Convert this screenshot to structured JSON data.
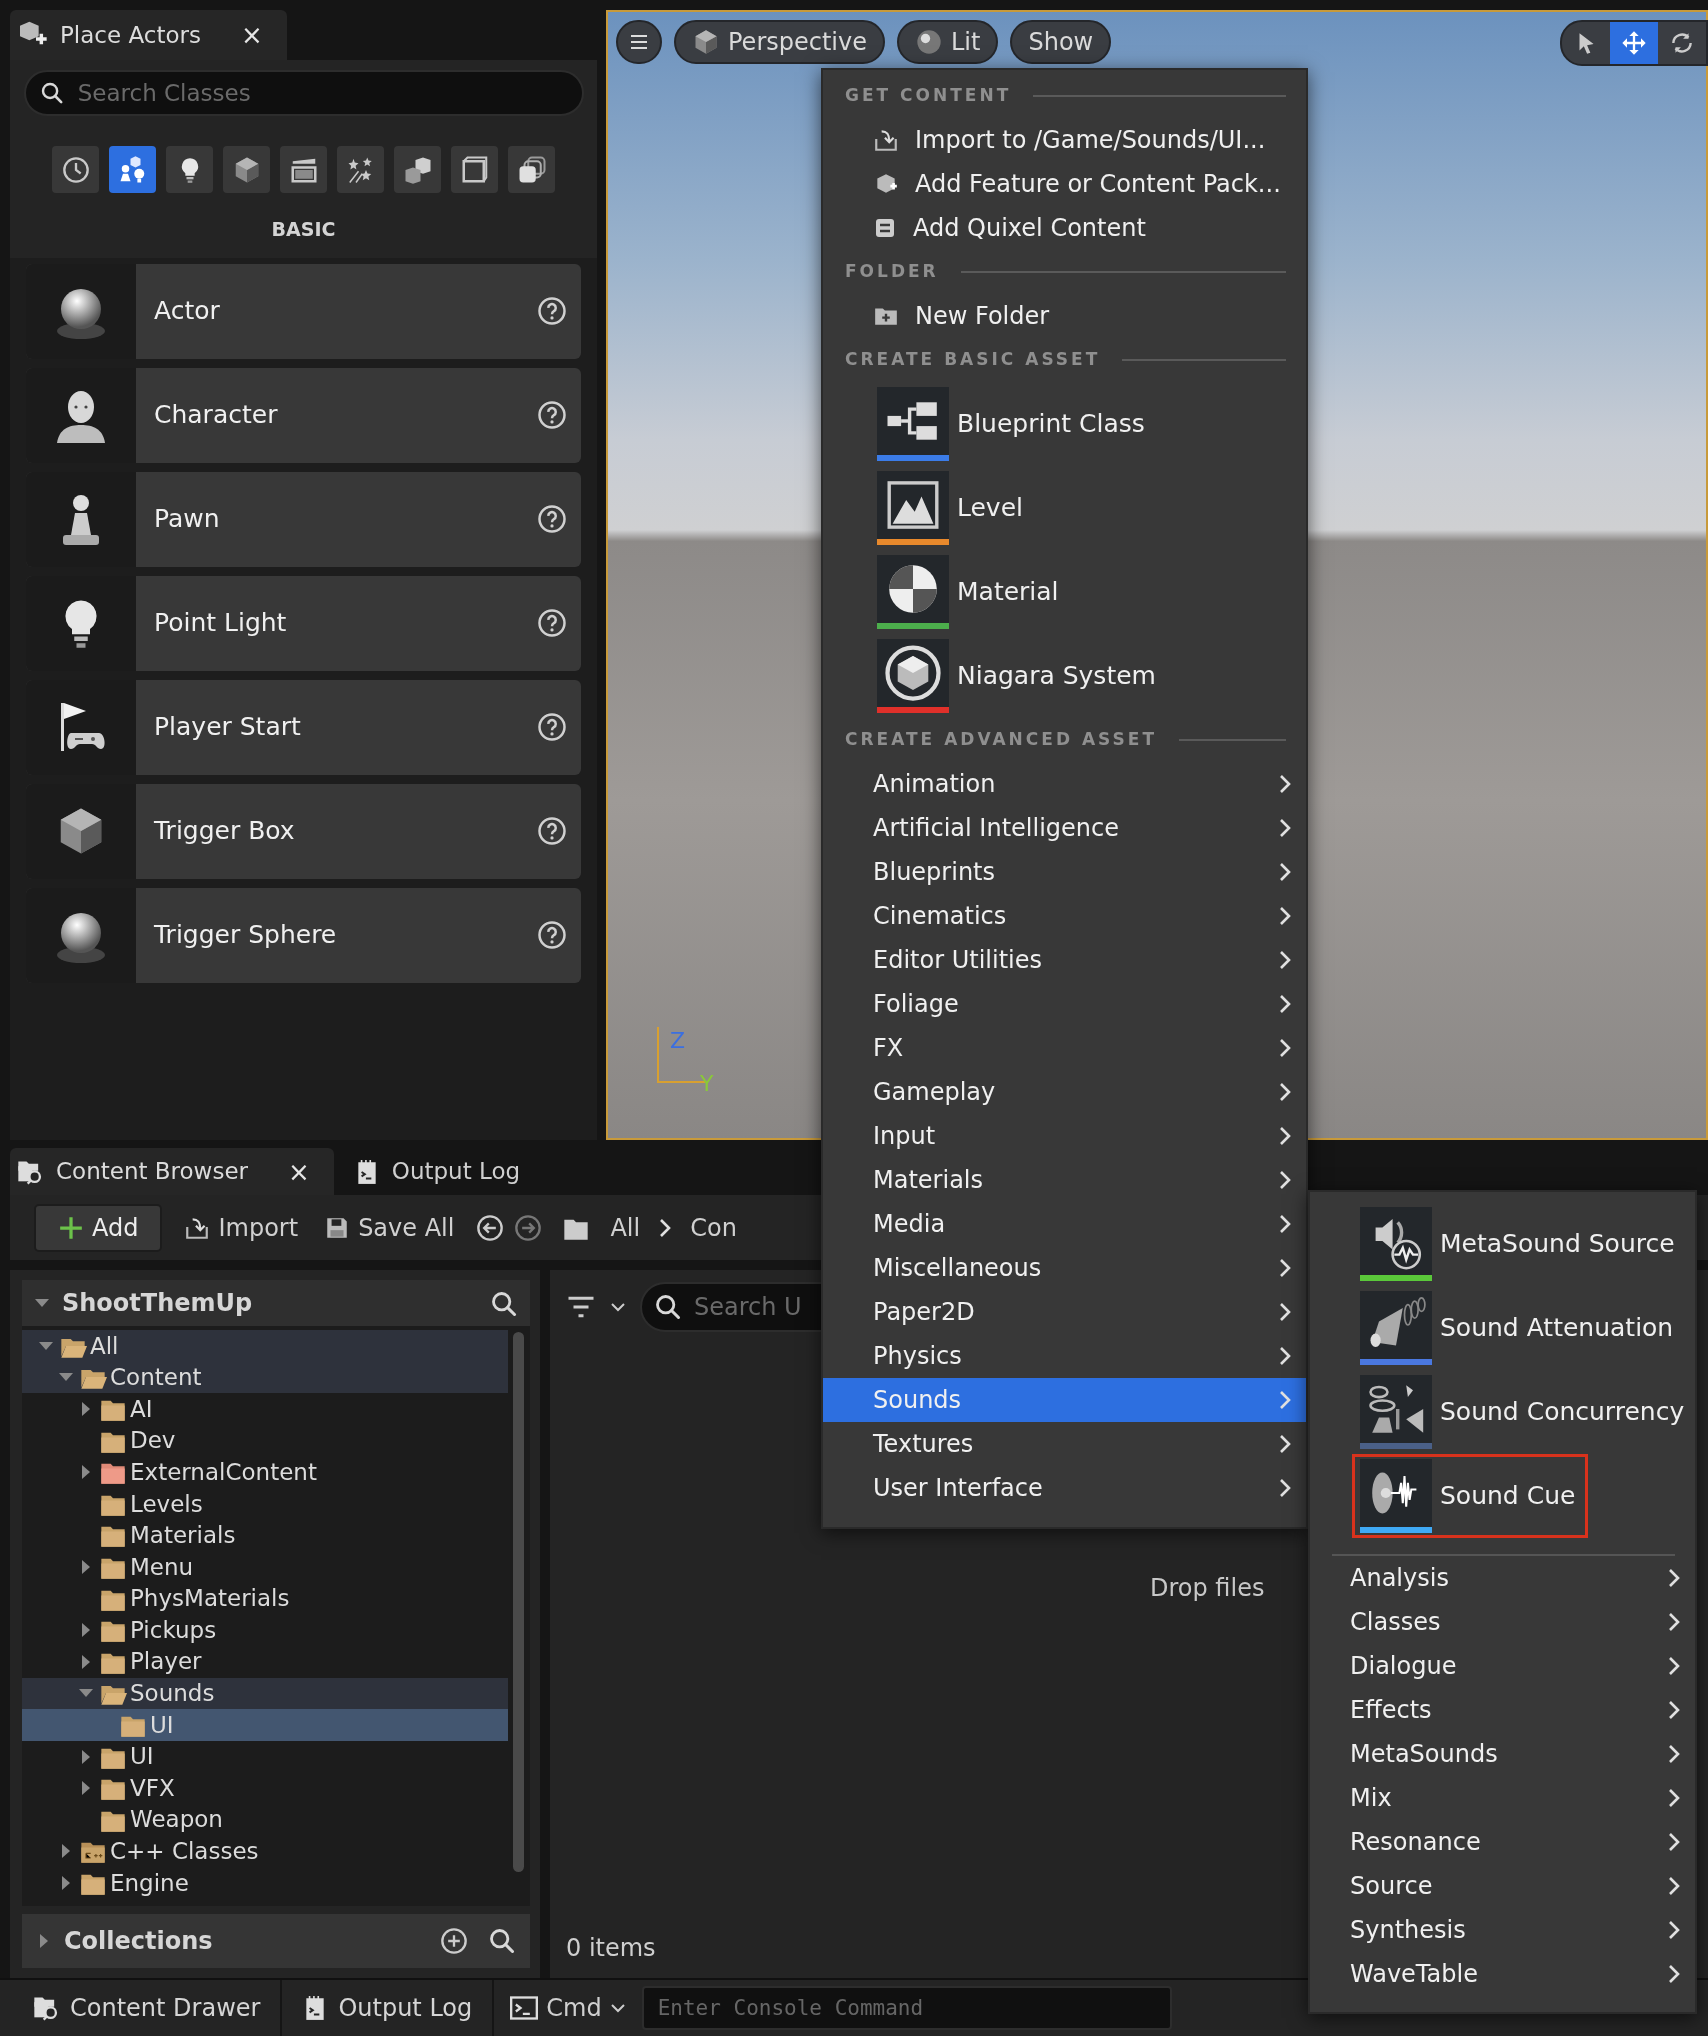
{
  "place_actors": {
    "tab": {
      "title": "Place Actors",
      "close": "×"
    },
    "search": {
      "placeholder": "Search Classes"
    },
    "categories": [
      {
        "kind": "clock",
        "selected": false
      },
      {
        "kind": "basic",
        "selected": true
      },
      {
        "kind": "bulb",
        "selected": false
      },
      {
        "kind": "cube",
        "selected": false
      },
      {
        "kind": "clapper",
        "selected": false
      },
      {
        "kind": "stars",
        "selected": false
      },
      {
        "kind": "blocks",
        "selected": false
      },
      {
        "kind": "volume",
        "selected": false
      },
      {
        "kind": "stack",
        "selected": false
      }
    ],
    "category_title": "BASIC",
    "actors": [
      {
        "name": "Actor",
        "kind": "sphere"
      },
      {
        "name": "Character",
        "kind": "person"
      },
      {
        "name": "Pawn",
        "kind": "pawn"
      },
      {
        "name": "Point Light",
        "kind": "bulb"
      },
      {
        "name": "Player Start",
        "kind": "flag"
      },
      {
        "name": "Trigger Box",
        "kind": "cube"
      },
      {
        "name": "Trigger Sphere",
        "kind": "sphere"
      }
    ]
  },
  "viewport": {
    "toolbar": [
      {
        "kind": "menu"
      },
      {
        "kind": "cube",
        "label": "Perspective"
      },
      {
        "kind": "lit",
        "label": "Lit"
      },
      {
        "kind": "plain",
        "label": "Show"
      }
    ],
    "transform_tools": [
      {
        "kind": "select",
        "selected": false
      },
      {
        "kind": "move",
        "selected": true
      },
      {
        "kind": "rotate",
        "selected": false
      }
    ],
    "axis_gizmo": {
      "z": "Z",
      "y": "Y"
    }
  },
  "content_browser": {
    "tabs": [
      {
        "label": "Content Browser",
        "kind": "drawer",
        "selected": true,
        "close": "×"
      },
      {
        "label": "Output Log",
        "kind": "log",
        "selected": false
      }
    ],
    "toolbar": {
      "add": "Add",
      "import": "Import",
      "save_all": "Save All",
      "breadcrumb": [
        "All",
        "Con"
      ]
    },
    "sources": {
      "title": "ShootThemUp",
      "tree": [
        {
          "label": "All",
          "kind": "folder",
          "expandable": true,
          "expanded": true,
          "selected": false,
          "children": [
            {
              "label": "Content",
              "kind": "folder",
              "expandable": true,
              "expanded": true,
              "selected": false,
              "children": [
                {
                  "label": "AI",
                  "kind": "folder",
                  "expandable": true,
                  "expanded": false,
                  "selected": false
                },
                {
                  "label": "Dev",
                  "kind": "folder",
                  "expandable": false,
                  "expanded": false,
                  "selected": false
                },
                {
                  "label": "ExternalContent",
                  "kind": "external",
                  "expandable": true,
                  "expanded": false,
                  "selected": false
                },
                {
                  "label": "Levels",
                  "kind": "folder",
                  "expandable": false,
                  "expanded": false,
                  "selected": false
                },
                {
                  "label": "Materials",
                  "kind": "folder",
                  "expandable": false,
                  "expanded": false,
                  "selected": false
                },
                {
                  "label": "Menu",
                  "kind": "folder",
                  "expandable": true,
                  "expanded": false,
                  "selected": false
                },
                {
                  "label": "PhysMaterials",
                  "kind": "folder",
                  "expandable": false,
                  "expanded": false,
                  "selected": false
                },
                {
                  "label": "Pickups",
                  "kind": "folder",
                  "expandable": true,
                  "expanded": false,
                  "selected": false
                },
                {
                  "label": "Player",
                  "kind": "folder",
                  "expandable": true,
                  "expanded": false,
                  "selected": false
                },
                {
                  "label": "Sounds",
                  "kind": "folder",
                  "expandable": true,
                  "expanded": true,
                  "selected": false,
                  "children": [
                    {
                      "label": "UI",
                      "kind": "folder",
                      "expandable": false,
                      "expanded": false,
                      "selected": true
                    }
                  ]
                },
                {
                  "label": "UI",
                  "kind": "folder",
                  "expandable": true,
                  "expanded": false,
                  "selected": false
                },
                {
                  "label": "VFX",
                  "kind": "folder",
                  "expandable": true,
                  "expanded": false,
                  "selected": false
                },
                {
                  "label": "Weapon",
                  "kind": "folder",
                  "expandable": false,
                  "expanded": false,
                  "selected": false
                }
              ]
            },
            {
              "label": "C++ Classes",
              "kind": "code",
              "expandable": true,
              "expanded": false,
              "selected": false
            },
            {
              "label": "Engine",
              "kind": "folder",
              "expandable": true,
              "expanded": false,
              "selected": false
            }
          ]
        }
      ],
      "collections": "Collections"
    },
    "assets": {
      "search": {
        "placeholder": "Search U"
      },
      "drop_hint": "Drop files",
      "count": "0 items"
    }
  },
  "status_bar": {
    "buttons": [
      {
        "label": "Content Drawer",
        "kind": "drawer"
      },
      {
        "label": "Output Log",
        "kind": "log"
      }
    ],
    "console": {
      "label": "Cmd",
      "placeholder": "Enter Console Command"
    }
  },
  "add_menu": {
    "sections": [
      {
        "title": "GET CONTENT",
        "kind": "small",
        "items": [
          {
            "label": "Import to /Game/Sounds/UI...",
            "kind": "import"
          },
          {
            "label": "Add Feature or Content Pack...",
            "kind": "pack"
          },
          {
            "label": "Add Quixel Content",
            "kind": "quixel"
          }
        ]
      },
      {
        "title": "FOLDER",
        "kind": "small",
        "items": [
          {
            "label": "New Folder",
            "kind": "newfolder"
          }
        ]
      },
      {
        "title": "CREATE BASIC ASSET",
        "kind": "large",
        "items": [
          {
            "label": "Blueprint Class",
            "kind": "blueprint",
            "color": "#3b7ce8"
          },
          {
            "label": "Level",
            "kind": "level",
            "color": "#e8892c"
          },
          {
            "label": "Material",
            "kind": "material",
            "color": "#4cae4c"
          },
          {
            "label": "Niagara System",
            "kind": "niagara",
            "color": "#e0302a"
          }
        ]
      },
      {
        "title": "CREATE ADVANCED ASSET",
        "kind": "submenu",
        "items": [
          {
            "label": "Animation",
            "selected": false
          },
          {
            "label": "Artificial Intelligence",
            "selected": false
          },
          {
            "label": "Blueprints",
            "selected": false
          },
          {
            "label": "Cinematics",
            "selected": false
          },
          {
            "label": "Editor Utilities",
            "selected": false
          },
          {
            "label": "Foliage",
            "selected": false
          },
          {
            "label": "FX",
            "selected": false
          },
          {
            "label": "Gameplay",
            "selected": false
          },
          {
            "label": "Input",
            "selected": false
          },
          {
            "label": "Materials",
            "selected": false
          },
          {
            "label": "Media",
            "selected": false
          },
          {
            "label": "Miscellaneous",
            "selected": false
          },
          {
            "label": "Paper2D",
            "selected": false
          },
          {
            "label": "Physics",
            "selected": false
          },
          {
            "label": "Sounds",
            "selected": true
          },
          {
            "label": "Textures",
            "selected": false
          },
          {
            "label": "User Interface",
            "selected": false
          }
        ]
      }
    ]
  },
  "sounds_submenu": {
    "assets": [
      {
        "label": "MetaSound Source",
        "kind": "metasound",
        "color": "#5ac83a",
        "highlighted": false
      },
      {
        "label": "Sound Attenuation",
        "kind": "attenuation",
        "color": "#4a78e0",
        "highlighted": false
      },
      {
        "label": "Sound Concurrency",
        "kind": "concurrency",
        "color": "#4a6088",
        "highlighted": false
      },
      {
        "label": "Sound Cue",
        "kind": "soundcue",
        "color": "#3fa9f5",
        "highlighted": true
      }
    ],
    "categories": [
      {
        "label": "Analysis"
      },
      {
        "label": "Classes"
      },
      {
        "label": "Dialogue"
      },
      {
        "label": "Effects"
      },
      {
        "label": "MetaSounds"
      },
      {
        "label": "Mix"
      },
      {
        "label": "Resonance"
      },
      {
        "label": "Source"
      },
      {
        "label": "Synthesis"
      },
      {
        "label": "WaveTable"
      }
    ]
  }
}
